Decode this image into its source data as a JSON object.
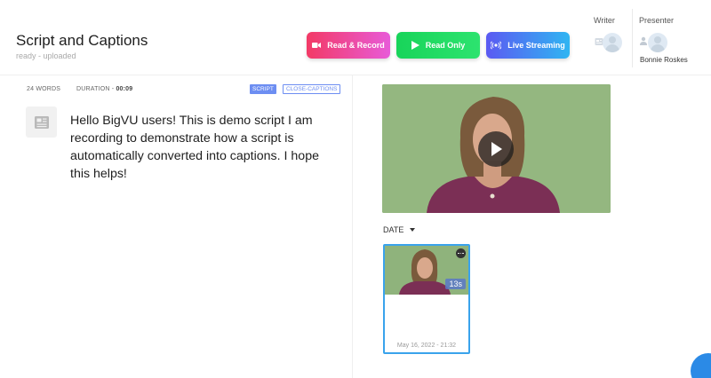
{
  "header": {
    "title": "Script and Captions",
    "status": "ready - uploaded"
  },
  "actions": {
    "read_record": "Read & Record",
    "read_only": "Read Only",
    "live_streaming": "Live Streaming"
  },
  "roles": {
    "writer_label": "Writer",
    "presenter_label": "Presenter",
    "presenter_name": "Bonnie Roskes"
  },
  "script": {
    "words": "24 WORDS",
    "duration_label": "DURATION -",
    "duration_value": "00:09",
    "tab_script": "SCRIPT",
    "tab_captions": "CLOSE-CAPTIONS",
    "text": "Hello BigVU users! This is demo script I am recording to demonstrate how a script is automatically converted into captions. I hope this helps!"
  },
  "videos": {
    "filter_label": "DATE",
    "items": [
      {
        "duration": "13s",
        "date": "May 16, 2022 - 21:32"
      }
    ]
  },
  "colors": {
    "accent": "#3aa3ec",
    "tag": "#6d8ef2",
    "video_bg": "#8fb37c"
  }
}
